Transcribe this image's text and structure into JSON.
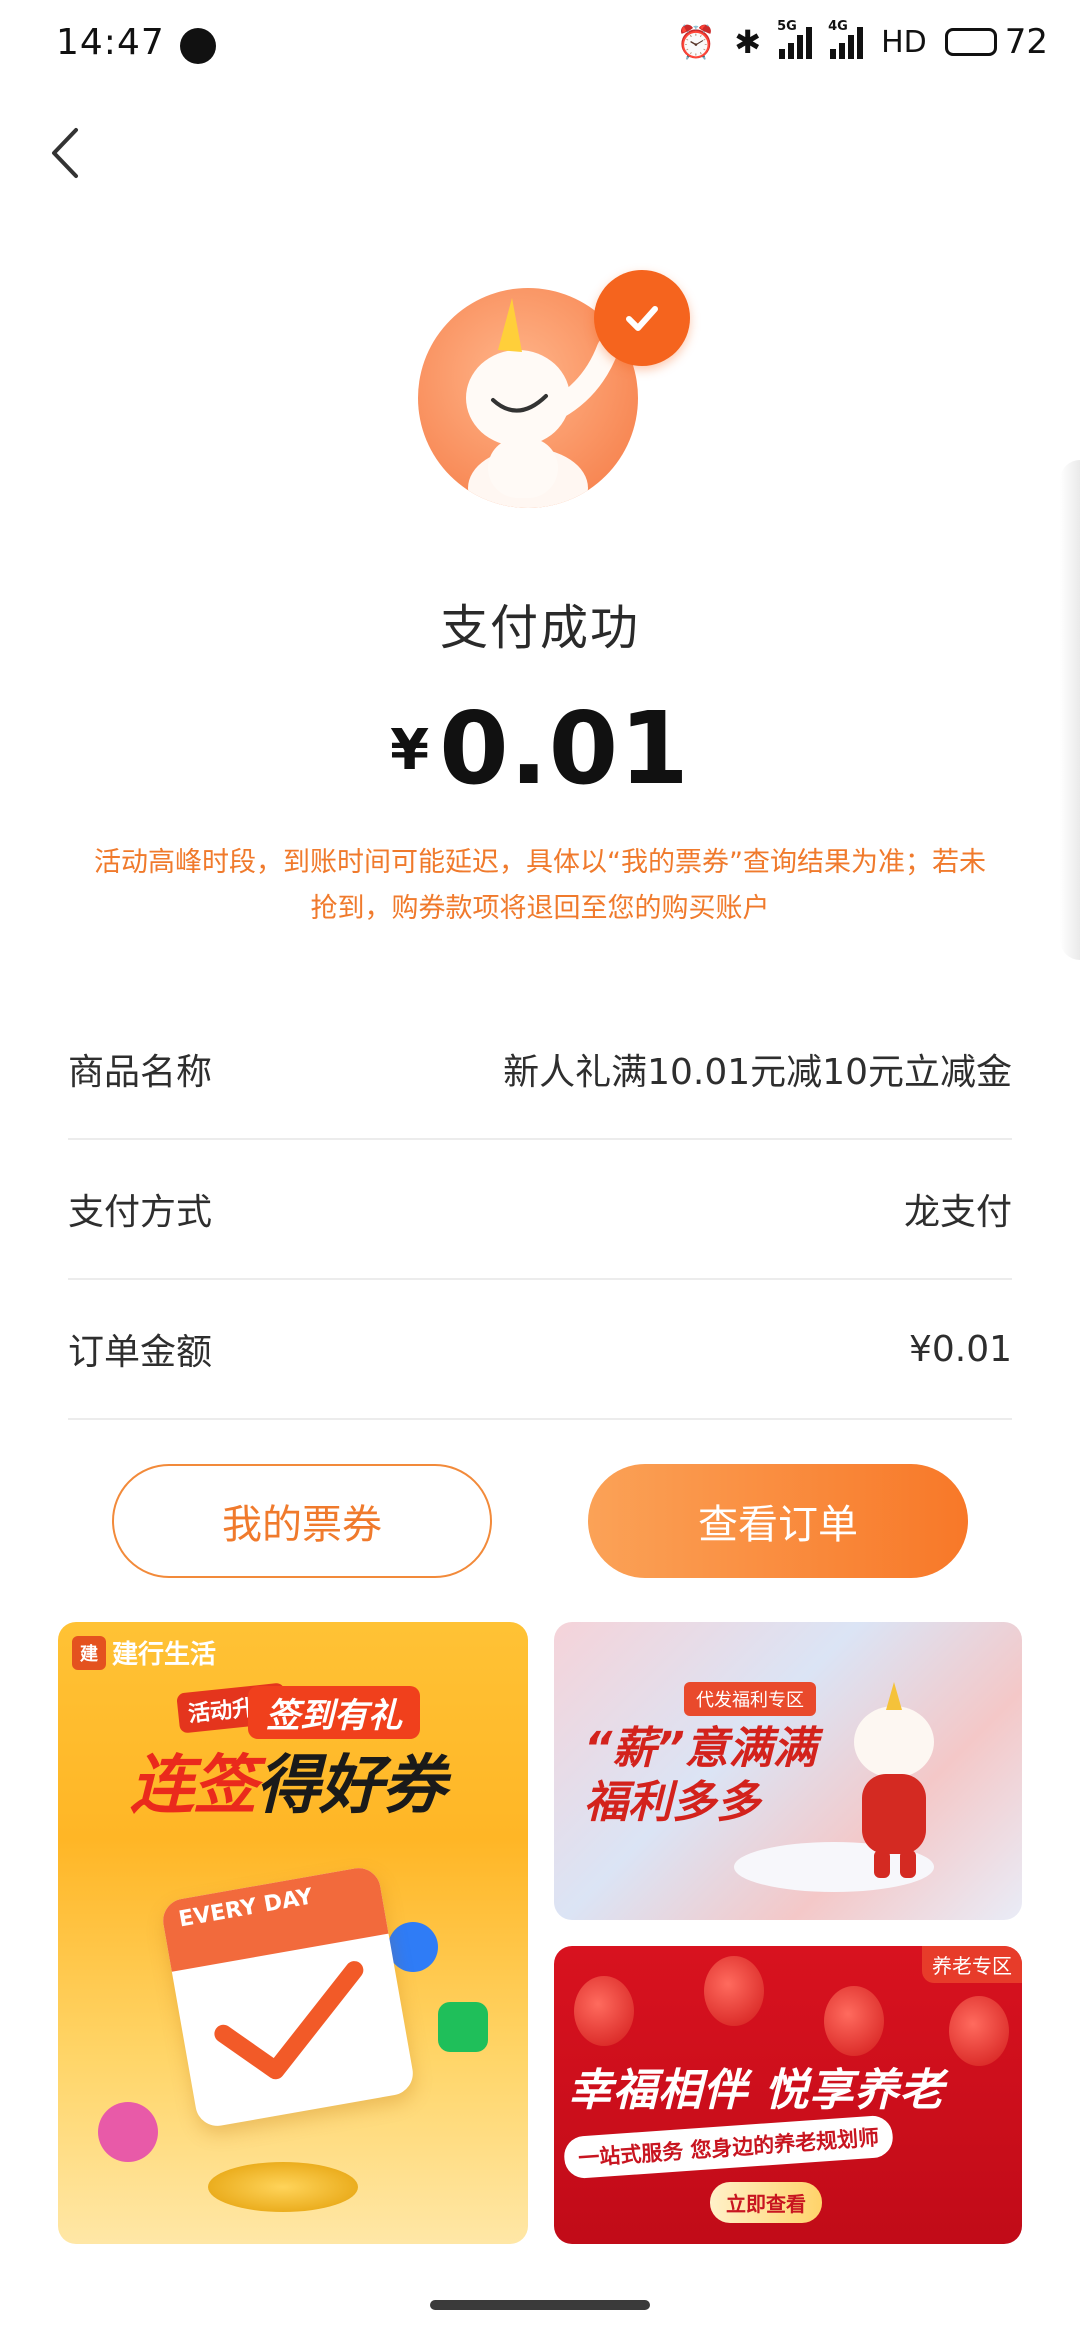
{
  "status_bar": {
    "time": "14:47",
    "network_1": "5G",
    "network_2": "4G",
    "hd": "HD",
    "battery": "72"
  },
  "result": {
    "title": "支付成功",
    "currency": "¥",
    "amount": "0.01",
    "notice": "活动高峰时段，到账时间可能延迟，具体以“我的票券”查询结果为准；若未抢到，购券款项将退回至您的购买账户"
  },
  "details": [
    {
      "key": "商品名称",
      "value": "新人礼满10.01元减10元立减金"
    },
    {
      "key": "支付方式",
      "value": "龙支付"
    },
    {
      "key": "订单金额",
      "value": "¥0.01"
    }
  ],
  "buttons": {
    "my_tickets": "我的票券",
    "view_order": "查看订单"
  },
  "banners": {
    "left": {
      "brand": "建行生活",
      "tag": "活动升级",
      "sub": "签到有礼",
      "headline_red": "连签",
      "headline_black": "得好券",
      "calendar_label": "EVERY DAY"
    },
    "right_top": {
      "tag": "代发福利专区",
      "line1": "“薪”意满满",
      "line2": "福利多多"
    },
    "right_bottom": {
      "corner": "养老专区",
      "title": "幸福相伴 悦享养老",
      "sub": "一站式服务 您身边的养老规划师",
      "cta": "立即查看"
    }
  },
  "colors": {
    "accent": "#f07a2c",
    "button_gradient_start": "#fba257",
    "button_gradient_end": "#f87828",
    "check_badge": "#f5641e"
  }
}
